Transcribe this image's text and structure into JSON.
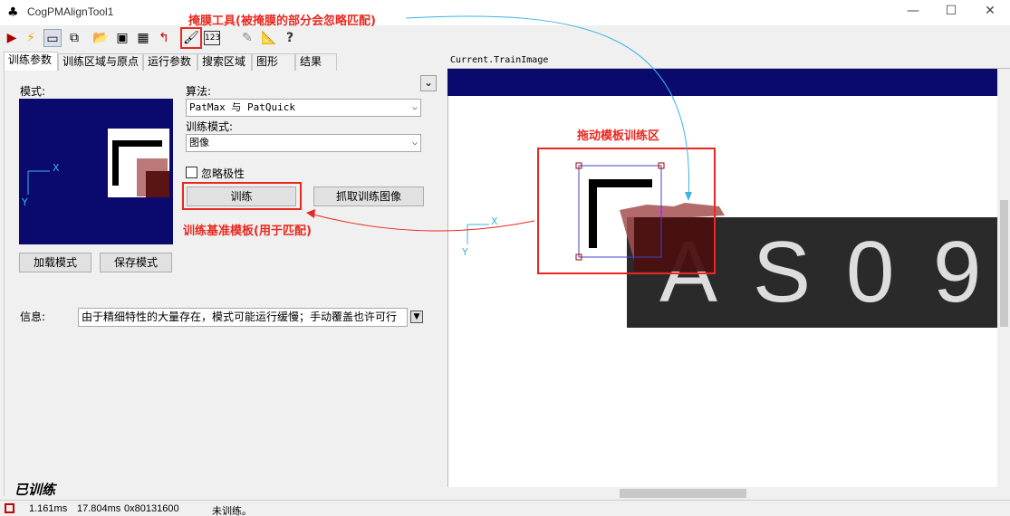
{
  "window": {
    "title": "CogPMAlignTool1",
    "controls": {
      "minimize": "—",
      "maximize": "☐",
      "close": "✕"
    }
  },
  "toolbar": {
    "icons": [
      "run-icon",
      "lightning-icon",
      "view-icon",
      "view-alt-icon",
      "open-folder-icon",
      "save-icon",
      "properties-icon",
      "reset-icon",
      "mask-brush-icon",
      "numeric-icon",
      "edit-graphics-icon",
      "ruler-icon",
      "help-icon"
    ],
    "numeric_label": "123"
  },
  "tabs": [
    "训练参数",
    "训练区域与原点",
    "运行参数",
    "搜索区域",
    "图形",
    "结果"
  ],
  "train_params": {
    "model_label": "模式:",
    "algorithm_label": "算法:",
    "algorithm_value": "PatMax 与 PatQuick",
    "train_mode_label": "训练模式:",
    "train_mode_value": "图像",
    "ignore_polarity_label": "忽略极性",
    "train_button": "训练",
    "grab_train_image_button": "抓取训练图像",
    "load_model_button": "加载模式",
    "save_model_button": "保存模式",
    "info_label": "信息:",
    "info_text": "由于精细特性的大量存在，模式可能运行缓慢；手动覆盖也许可行",
    "trained_status": "已训练",
    "expand_icon": "⌄"
  },
  "image_panel": {
    "title": "Current.TrainImage",
    "characters": [
      "A",
      "S",
      "0",
      "9"
    ]
  },
  "annotations": {
    "mask_tool": "掩膜工具(被掩膜的部分会忽略匹配)",
    "drag_region": "拖动模板训练区",
    "train_reference": "训练基准模板(用于匹配)"
  },
  "axes": {
    "x": "X",
    "y": "Y"
  },
  "status": {
    "time1": "1.161ms",
    "time2": "17.804ms",
    "address": "0x80131600",
    "message": "未训练。"
  },
  "colors": {
    "accent_red": "#e8281e",
    "banner_blue": "#0a0a6e",
    "cyan": "#3ab4e0"
  }
}
